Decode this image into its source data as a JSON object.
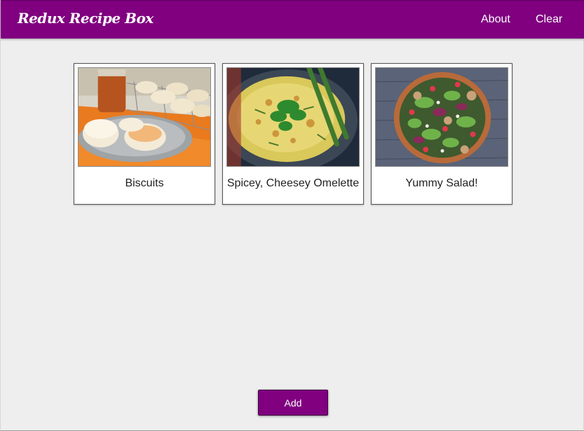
{
  "navbar": {
    "brand": "Redux Recipe Box",
    "links": [
      "About",
      "Clear"
    ],
    "background_color": "#800080"
  },
  "recipes": [
    {
      "title": "Biscuits",
      "image": "biscuits-photo"
    },
    {
      "title": "Spicey, Cheesey Omelette",
      "image": "omelette-photo"
    },
    {
      "title": "Yummy Salad!",
      "image": "salad-photo"
    }
  ],
  "actions": {
    "add_label": "Add"
  }
}
